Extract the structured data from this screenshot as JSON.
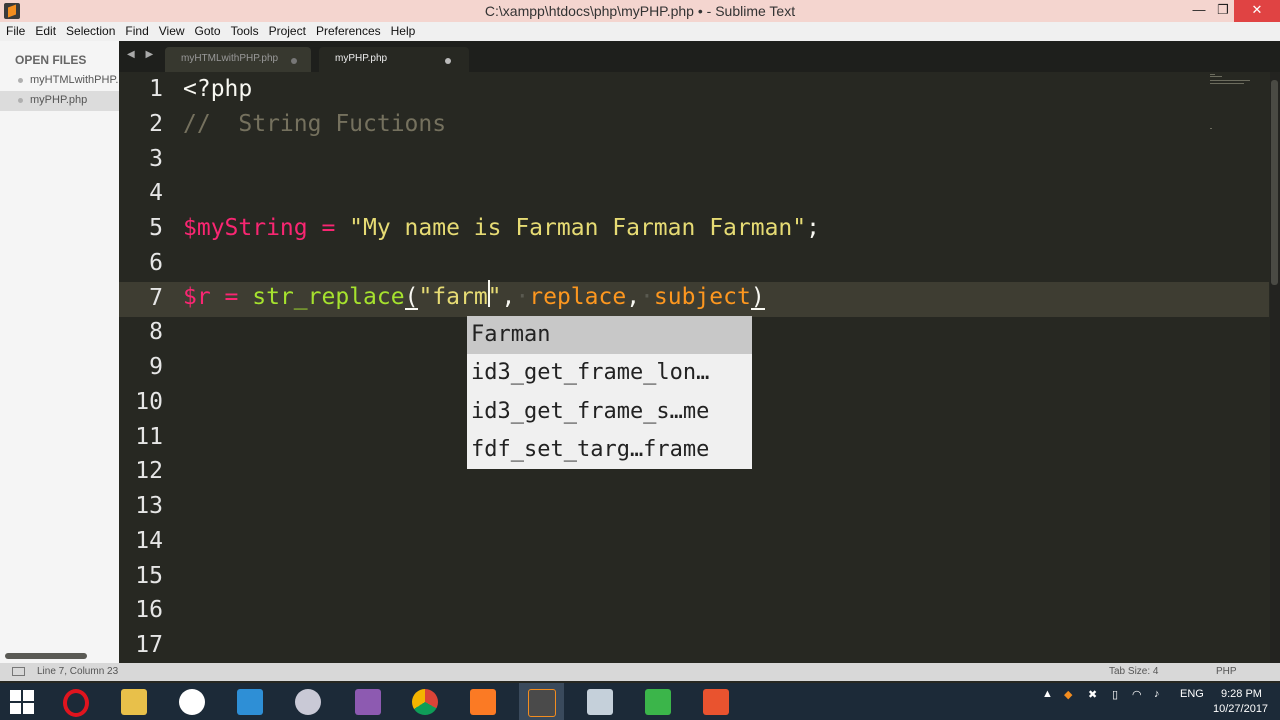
{
  "window": {
    "title": "C:\\xampp\\htdocs\\php\\myPHP.php • - Sublime Text",
    "minimize": "—",
    "maximize": "❐",
    "close": "✕"
  },
  "menu": [
    "File",
    "Edit",
    "Selection",
    "Find",
    "View",
    "Goto",
    "Tools",
    "Project",
    "Preferences",
    "Help"
  ],
  "sidebar": {
    "heading": "OPEN FILES",
    "files": [
      {
        "name": "myHTMLwithPHP.php"
      },
      {
        "name": "myPHP.php"
      }
    ]
  },
  "tabs": {
    "nav": "◀ ▶",
    "items": [
      {
        "label": "myHTMLwithPHP.php",
        "active": false
      },
      {
        "label": "myPHP.php",
        "active": true
      }
    ]
  },
  "editor": {
    "line_numbers": [
      "1",
      "2",
      "3",
      "4",
      "5",
      "6",
      "7",
      "8",
      "9",
      "10",
      "11",
      "12",
      "13",
      "14",
      "15",
      "16",
      "17"
    ],
    "current_line": 7,
    "code": {
      "l1": "<?php",
      "l2": "//  String Fuctions",
      "l5_var": "$myString",
      "l5_eq": " = ",
      "l5_str": "\"My name is Farman Farman Farman\"",
      "l5_end": ";",
      "l7_var": "$r",
      "l7_eq": " = ",
      "l7_func": "str_replace",
      "l7_open": "(",
      "l7_str": "\"farm\"",
      "l7_comma1": ",",
      "l7_ws1": "·",
      "l7_p1": "replace",
      "l7_comma2": ",",
      "l7_ws2": "·",
      "l7_p2": "subject",
      "l7_close": ")"
    }
  },
  "autocomplete": [
    "Farman",
    "id3_get_frame_lon…",
    "id3_get_frame_s…me",
    "fdf_set_targ…frame"
  ],
  "status": {
    "position": "Line 7, Column 23",
    "tab_size": "Tab Size: 4",
    "syntax": "PHP"
  },
  "taskbar": {
    "apps": [
      "opera-icon",
      "file-explorer-icon",
      "git-icon",
      "notepad-icon",
      "paint-icon",
      "winrar-icon",
      "chrome-icon",
      "xampp-icon",
      "sublime-icon",
      "network-icon",
      "camtasia-green-icon",
      "camtasia-orange-icon"
    ],
    "tray": {
      "language": "ENG",
      "time": "9:28 PM",
      "date": "10/27/2017"
    }
  }
}
